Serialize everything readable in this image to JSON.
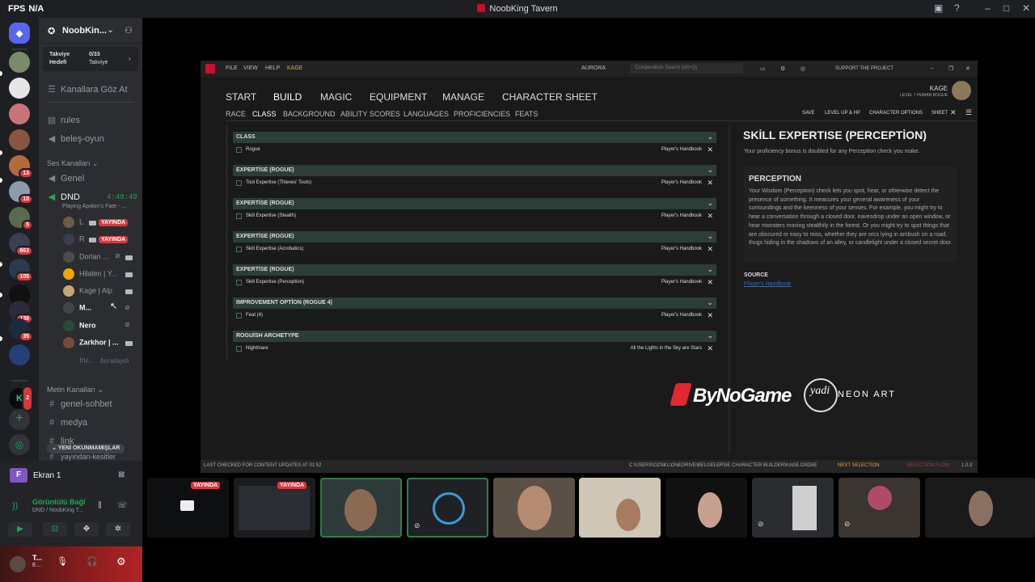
{
  "window": {
    "fps_label": "FPS",
    "fps_value": "N/A",
    "title": "NoobKing Tavern"
  },
  "server": {
    "name": "NoobKin...",
    "boost": {
      "label1": "Takviye",
      "label2": "Hedefi",
      "value": "0/33",
      "label3": "Takviye"
    },
    "browse": "Kanallara Göz At",
    "text_top": [
      {
        "name": "rules"
      },
      {
        "name": "beleş-oyun"
      }
    ],
    "voice_category": "Ses Kanalları",
    "voice_channels": [
      {
        "name": "Genel"
      },
      {
        "name": "DND",
        "timer": "4:49:49",
        "activity": "Playing Apolon's Fate - ..."
      }
    ],
    "voice_users": [
      {
        "name": "L",
        "live": "YAYINDA"
      },
      {
        "name": "R",
        "live": "YAYINDA"
      },
      {
        "name": "Dorlan ..."
      },
      {
        "name": "Hilalen | Y..."
      },
      {
        "name": "Kage | Alp"
      },
      {
        "name": "M..."
      },
      {
        "name": "Nero"
      },
      {
        "name": "Zarkhor | ..."
      },
      {
        "name": "Iru...",
        "status": "buradaydı"
      }
    ],
    "text_category": "Metin Kanalları",
    "text_channels": [
      {
        "name": "genel-sohbet"
      },
      {
        "name": "medya"
      },
      {
        "name": "link"
      },
      {
        "name": "yayından-kesitler"
      }
    ],
    "unread_pill": "YENİ OKUNMAMIŞLAR"
  },
  "rail_badges": [
    "13",
    "10",
    "5",
    "863",
    "105",
    "138",
    "35",
    "2"
  ],
  "panel": {
    "screen": "Ekran 1",
    "connection": "Görüntülü Bağl",
    "connection_sub": "DND / NoobKing T...",
    "user": "T...",
    "user_sub": "E..."
  },
  "app": {
    "menu": [
      "FILE",
      "VIEW",
      "HELP",
      "KAGE"
    ],
    "center": "AURORA",
    "search_placeholder": "Compendium Search (Alt+Q)",
    "support": "SUPPORT THE PROJECT",
    "char_name": "KAGE",
    "char_sub": "LEVEL 7 HUMAN ROGUE",
    "nav": [
      "START",
      "BUILD",
      "MAGIC",
      "EQUIPMENT",
      "MANAGE",
      "CHARACTER SHEET"
    ],
    "subnav": [
      "RACE",
      "CLASS",
      "BACKGROUND",
      "ABILITY SCORES",
      "LANGUAGES",
      "PROFICIENCIES",
      "FEATS"
    ],
    "actions": [
      "SAVE",
      "LEVEL UP & HP",
      "CHARACTER OPTIONS",
      "SHEET"
    ],
    "sections": [
      {
        "header": "CLASS",
        "item": "Rogue",
        "source": "Player's Handbook"
      },
      {
        "header": "EXPERTİSE (ROGUE)",
        "item": "Tool Expertise (Thieves' Tools)",
        "source": "Player's Handbook"
      },
      {
        "header": "EXPERTİSE (ROGUE)",
        "item": "Skill Expertise (Stealth)",
        "source": "Player's Handbook"
      },
      {
        "header": "EXPERTİSE (ROGUE)",
        "item": "Skill Expertise (Acrobatics)",
        "source": "Player's Handbook"
      },
      {
        "header": "EXPERTİSE (ROGUE)",
        "item": "Skill Expertise (Perception)",
        "source": "Player's Handbook"
      },
      {
        "header": "IMPROVEMENT OPTİON (ROGUE 4)",
        "item": "Feat (4)",
        "source": "Player's Handbook"
      },
      {
        "header": "ROGUİSH ARCHETYPE",
        "item": "Nightmare",
        "source": "All the Lights in the Sky are Stars"
      }
    ],
    "detail": {
      "title": "SKİLL EXPERTISE (PERCEPTİON)",
      "desc": "Your proficiency bonus is doubled for any Perception check you make.",
      "box_title": "PERCEPTION",
      "box_text": "Your Wisdom (Perception) check lets you spot, hear, or otherwise detect the presence of something. It measures your general awareness of your surroundings and the keenness of your senses. For example, you might try to hear a conversation through a closed door, eavesdrop under an open window, or hear monsters moving stealthily in the forest. Or you might try to spot things that are obscured or easy to miss, whether they are orcs lying in ambush on a road, thugs hiding in the shadows of an alley, or candlelight under a closed secret door.",
      "source_label": "SOURCE",
      "source_link": "Player's Handbook"
    },
    "status_left": "LAST CHECKED FOR CONTENT UPDATES AT 01:52",
    "status_path": "C:\\USERS\\OZNKL\\ONEDRIVE\\BELGELER\\5E CHARACTER BUILDER\\KAGE.DND5E",
    "status_next": "NEXT SELECTION",
    "status_flow": "SELECTION FLOW",
    "version": "1.0.3"
  },
  "overlay": {
    "brand1": "ByNoGame",
    "brand2_script": "yadi",
    "brand2": "NEON ART"
  },
  "tiles_live": [
    "YAYINDA",
    "YAYINDA"
  ],
  "colors": {
    "live_red": "#da373c",
    "discord_green": "#23a55a",
    "aurora_red": "#c8102e",
    "section_green": "#2c3e37"
  }
}
